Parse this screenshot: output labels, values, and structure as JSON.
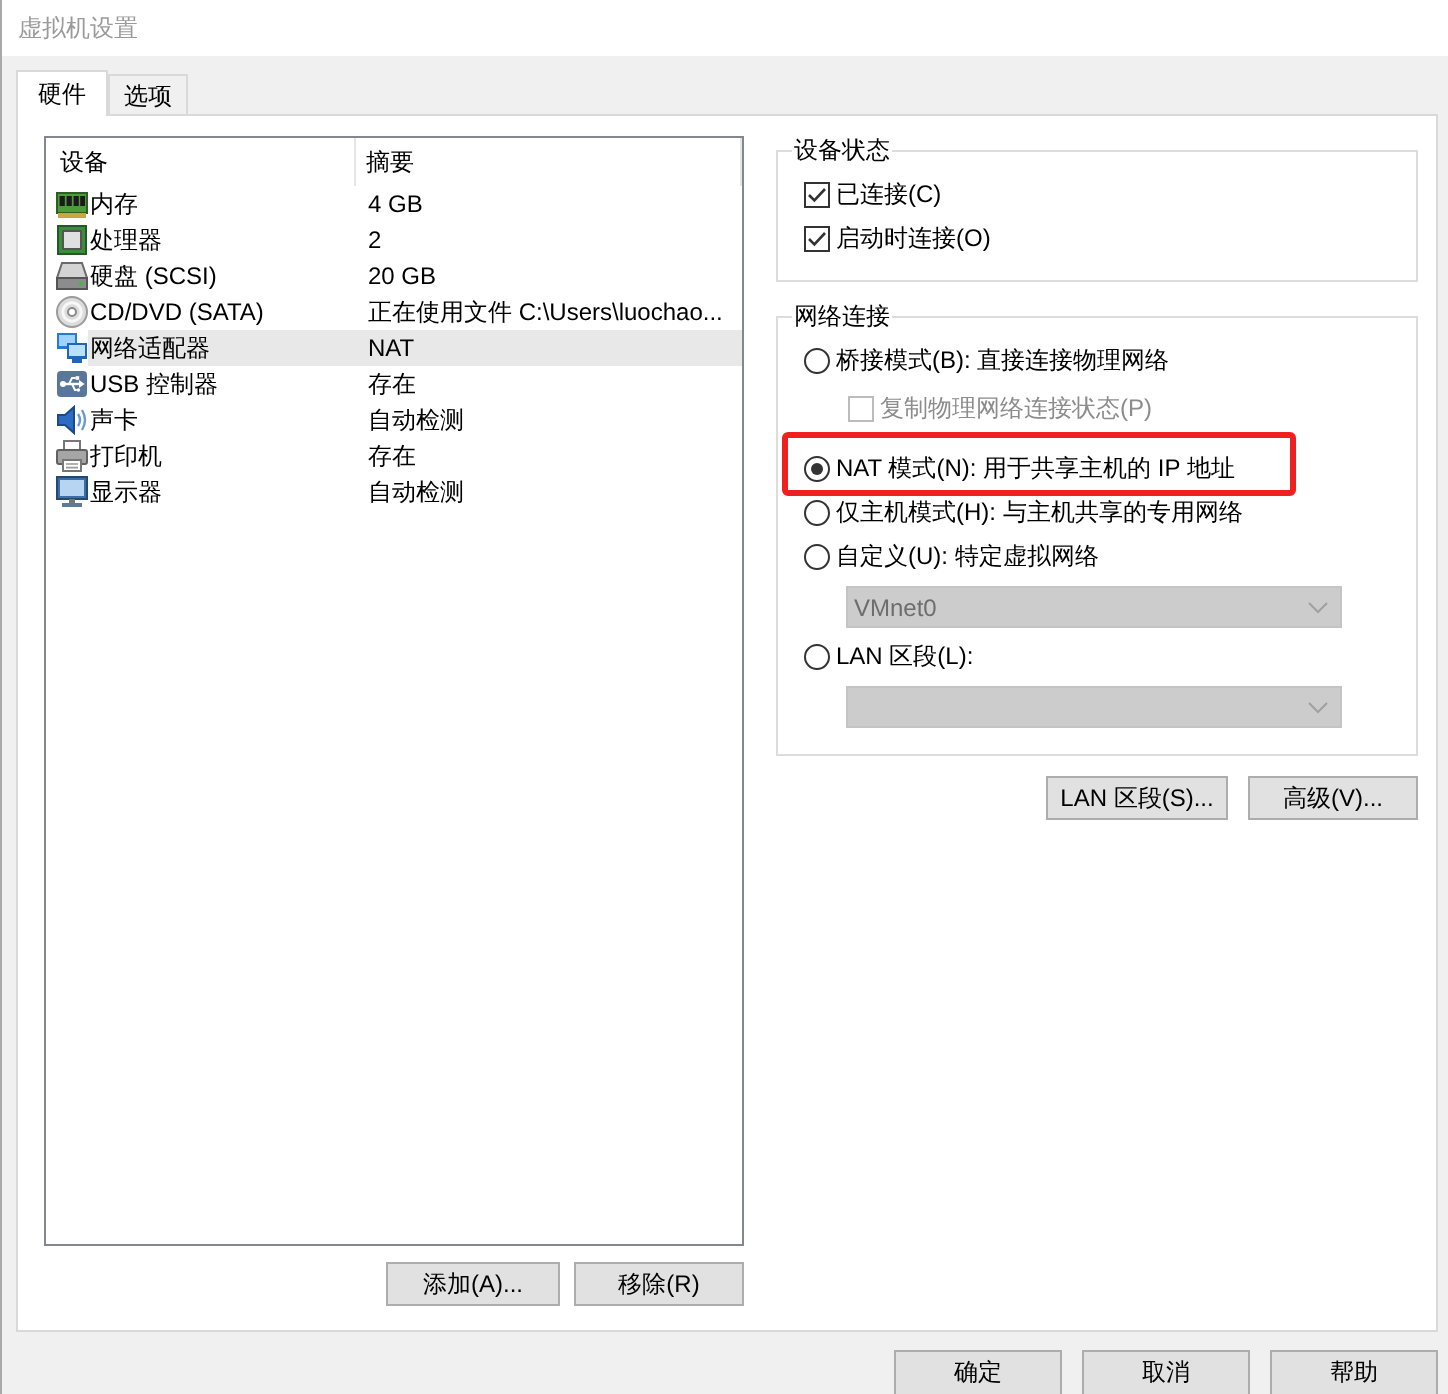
{
  "window": {
    "title": "虚拟机设置"
  },
  "tabs": [
    {
      "label": "硬件",
      "selected": true
    },
    {
      "label": "选项",
      "selected": false
    }
  ],
  "device_list": {
    "columns": [
      "设备",
      "摘要"
    ],
    "rows": [
      {
        "kind": "memory",
        "device": "内存",
        "summary": "4 GB",
        "selected": false
      },
      {
        "kind": "processor",
        "device": "处理器",
        "summary": "2",
        "selected": false
      },
      {
        "kind": "disk",
        "device": "硬盘 (SCSI)",
        "summary": "20 GB",
        "selected": false
      },
      {
        "kind": "optical",
        "device": "CD/DVD (SATA)",
        "summary": "正在使用文件 C:\\Users\\luochao...",
        "selected": false
      },
      {
        "kind": "network",
        "device": "网络适配器",
        "summary": "NAT",
        "selected": true
      },
      {
        "kind": "usb",
        "device": "USB 控制器",
        "summary": "存在",
        "selected": false
      },
      {
        "kind": "sound",
        "device": "声卡",
        "summary": "自动检测",
        "selected": false
      },
      {
        "kind": "printer",
        "device": "打印机",
        "summary": "存在",
        "selected": false
      },
      {
        "kind": "display",
        "device": "显示器",
        "summary": "自动检测",
        "selected": false
      }
    ]
  },
  "device_buttons": [
    "添加(A)...",
    "移除(R)"
  ],
  "device_status": {
    "title": "设备状态",
    "options": [
      {
        "label": "已连接(C)",
        "checked": true,
        "disabled": false
      },
      {
        "label": "启动时连接(O)",
        "checked": true,
        "disabled": false
      }
    ]
  },
  "network_connection": {
    "title": "网络连接",
    "options": [
      {
        "kind": "radio",
        "label": "桥接模式(B): 直接连接物理网络",
        "selected": false,
        "disabled": false,
        "highlighted": false
      },
      {
        "kind": "checkbox",
        "label": "复制物理网络连接状态(P)",
        "checked": false,
        "disabled": true
      },
      {
        "kind": "radio",
        "label": "NAT 模式(N): 用于共享主机的 IP 地址",
        "selected": true,
        "disabled": false,
        "highlighted": true
      },
      {
        "kind": "radio",
        "label": "仅主机模式(H): 与主机共享的专用网络",
        "selected": false,
        "disabled": false,
        "highlighted": false
      },
      {
        "kind": "radio",
        "label": "自定义(U): 特定虚拟网络",
        "selected": false,
        "disabled": false,
        "highlighted": false
      },
      {
        "kind": "dropdown",
        "value": "VMnet0",
        "disabled": true
      },
      {
        "kind": "radio",
        "label": "LAN 区段(L):",
        "selected": false,
        "disabled": false,
        "highlighted": false
      },
      {
        "kind": "dropdown",
        "disabled": true
      }
    ],
    "buttons": [
      "LAN 区段(S)...",
      "高级(V)..."
    ]
  },
  "dialog_buttons": [
    "确定",
    "取消",
    "帮助"
  ]
}
